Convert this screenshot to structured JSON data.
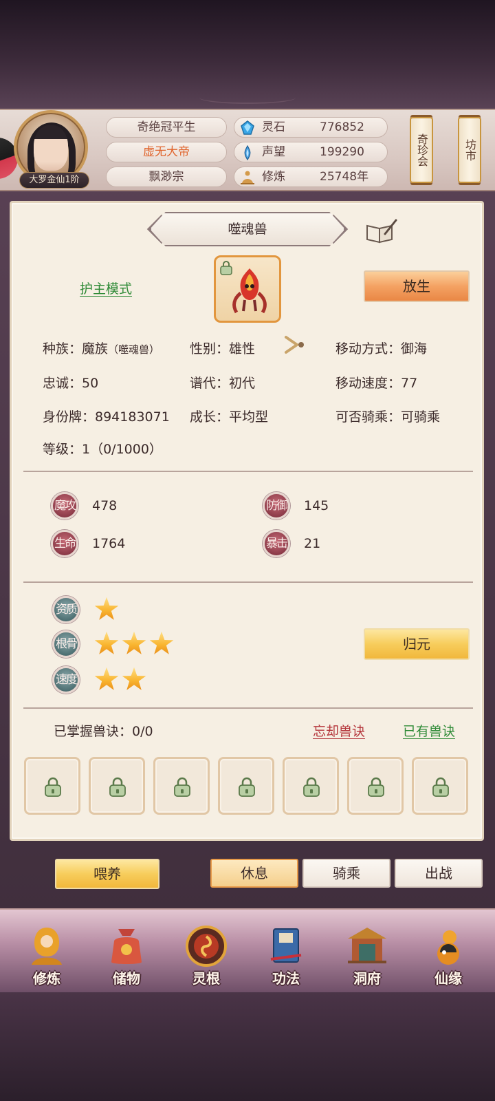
{
  "player": {
    "realm": "大罗金仙1阶",
    "name": "奇绝冠平生",
    "title": "虚无大帝",
    "sect": "飘渺宗"
  },
  "resources": [
    {
      "icon": "spirit-stone-icon",
      "label": "灵石",
      "value": "776852"
    },
    {
      "icon": "reputation-icon",
      "label": "声望",
      "value": "199290"
    },
    {
      "icon": "cultivate-icon",
      "label": "修炼",
      "value": "25748年"
    }
  ],
  "top_buttons": {
    "treasure": "奇珍会",
    "market": "坊市"
  },
  "pet": {
    "name": "噬魂兽",
    "mode_link": "护主模式",
    "release_button": "放生",
    "info": {
      "race_label": "种族：",
      "race_value": "魔族",
      "race_sub": "（噬魂兽）",
      "gender": "性别：雄性",
      "move_type": "移动方式：御海",
      "loyalty": "忠诚：50",
      "generation": "谱代：初代",
      "move_speed": "移动速度：77",
      "id_card": "身份牌：894183071",
      "growth": "成长：平均型",
      "rideable": "可否骑乘：可骑乘",
      "level": "等级：1（0/1000）"
    },
    "stats": [
      {
        "label": "魔攻",
        "value": "478"
      },
      {
        "label": "防御",
        "value": "145"
      },
      {
        "label": "生命",
        "value": "1764"
      },
      {
        "label": "暴击",
        "value": "21"
      }
    ],
    "qualities": [
      {
        "label": "资质",
        "stars": 1
      },
      {
        "label": "根骨",
        "stars": 3
      },
      {
        "label": "速度",
        "stars": 2
      }
    ],
    "reset_button": "归元",
    "skills": {
      "mastered": "已掌握兽诀：0/0",
      "forget_link": "忘却兽诀",
      "owned_link": "已有兽诀",
      "slot_count": 7
    }
  },
  "actions": {
    "feed": "喂养",
    "rest": "休息",
    "ride": "骑乘",
    "battle": "出战"
  },
  "nav": [
    {
      "icon": "cultivate-nav-icon",
      "label": "修炼"
    },
    {
      "icon": "storage-bag-icon",
      "label": "储物"
    },
    {
      "icon": "spirit-root-icon",
      "label": "灵根"
    },
    {
      "icon": "technique-book-icon",
      "label": "功法"
    },
    {
      "icon": "cave-mansion-icon",
      "label": "洞府"
    },
    {
      "icon": "fate-gourd-icon",
      "label": "仙缘"
    }
  ],
  "colors": {
    "title_orange": "#e0642c",
    "link_green": "#2e8a36",
    "link_red": "#b4343a",
    "stat_red": "#8e3c4a",
    "stat_teal": "#4f7174",
    "star": "#f9b530"
  }
}
